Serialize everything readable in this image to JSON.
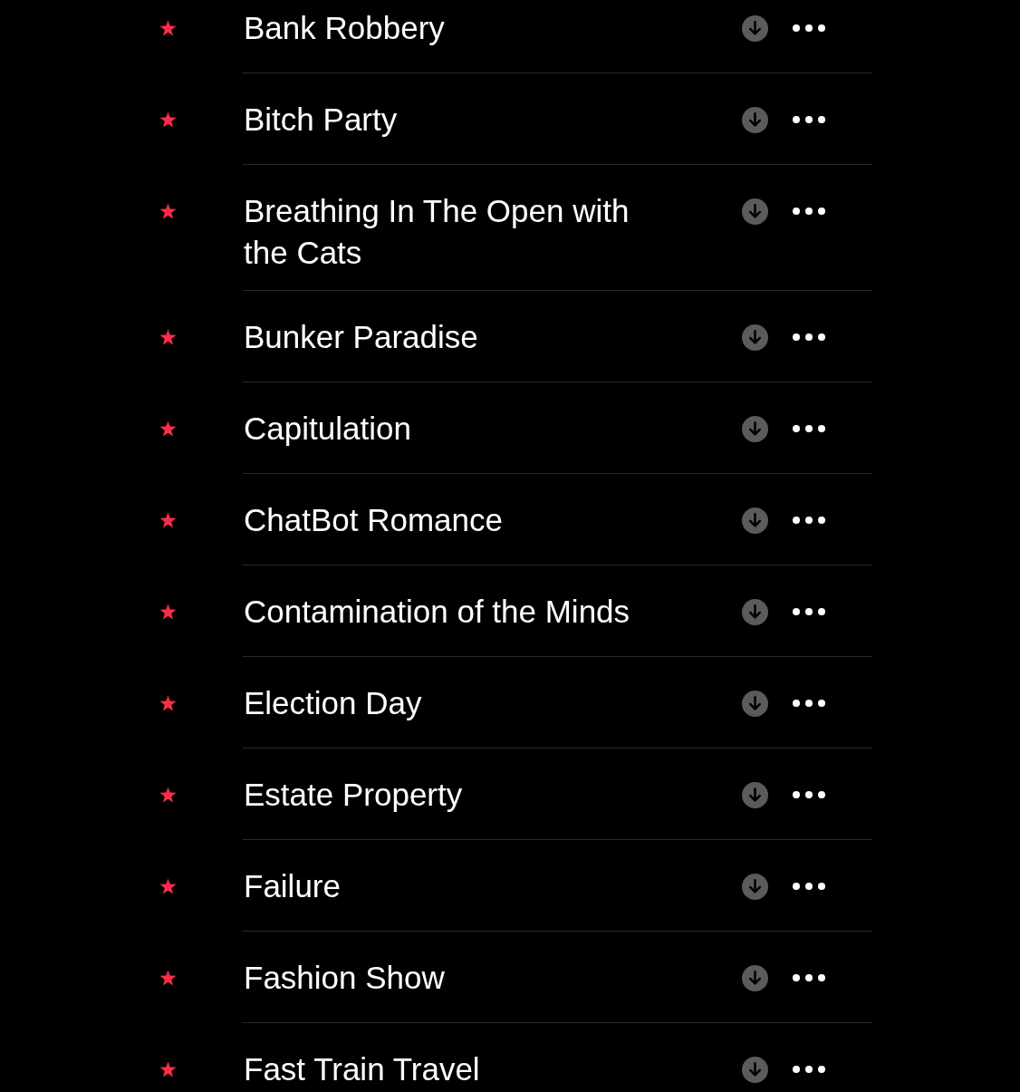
{
  "songs": [
    {
      "title": "Bank Robbery",
      "favorite": true
    },
    {
      "title": "Bitch Party",
      "favorite": true
    },
    {
      "title": "Breathing In The Open with the Cats",
      "favorite": true
    },
    {
      "title": "Bunker Paradise",
      "favorite": true
    },
    {
      "title": "Capitulation",
      "favorite": true
    },
    {
      "title": "ChatBot Romance",
      "favorite": true
    },
    {
      "title": "Contamination of the Minds",
      "favorite": true
    },
    {
      "title": "Election Day",
      "favorite": true
    },
    {
      "title": "Estate Property",
      "favorite": true
    },
    {
      "title": "Failure",
      "favorite": true
    },
    {
      "title": "Fashion Show",
      "favorite": true
    },
    {
      "title": "Fast Train Travel",
      "favorite": true
    }
  ]
}
